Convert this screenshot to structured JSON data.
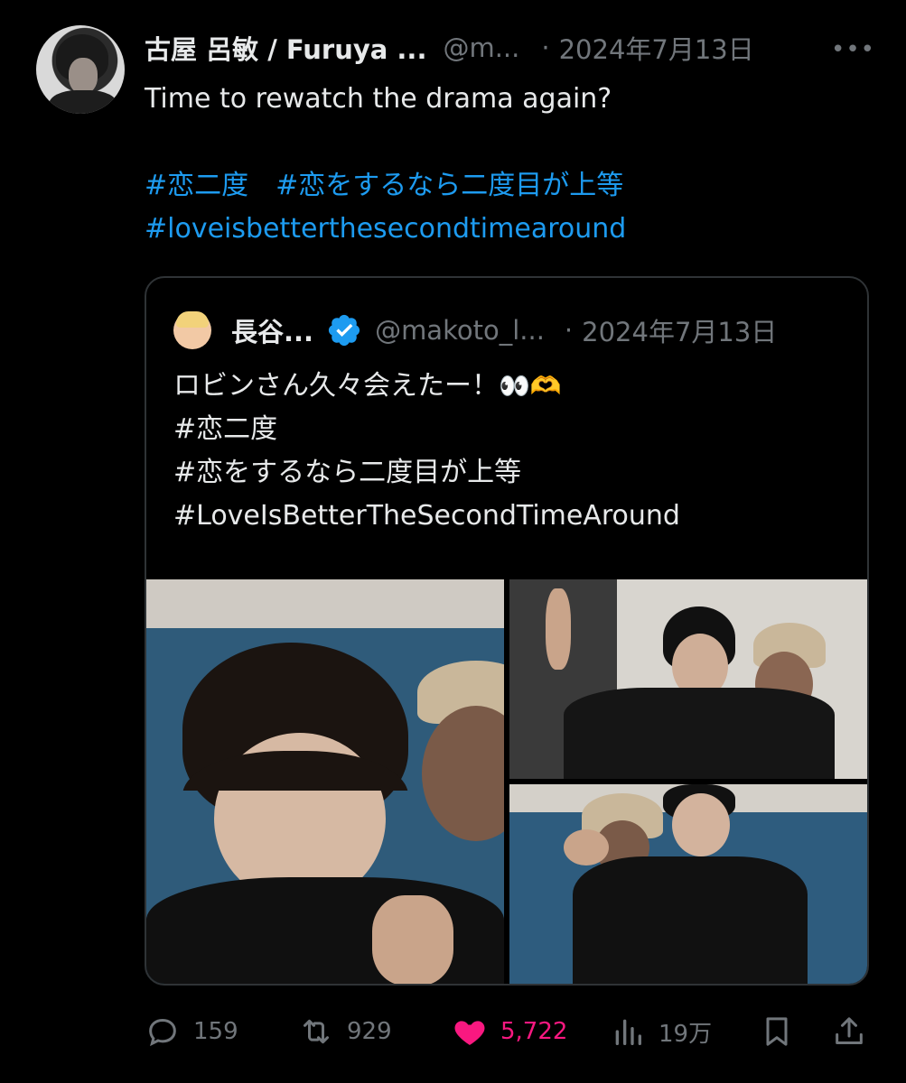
{
  "tweet": {
    "display_name": "古屋 呂敏 / Furuya ...",
    "handle": "@m...",
    "separator": "·",
    "date": "2024年7月13日",
    "more_label": "•••",
    "text": "Time to rewatch the drama again?",
    "hashtags_line1": [
      "#恋二度",
      "#恋をするなら二度目が上等"
    ],
    "hashtags_line2": "#loveisbetterthesecondtimearound"
  },
  "quote": {
    "display_name": "長谷...",
    "handle": "@makoto_l...",
    "separator": "·",
    "date": "2024年7月13日",
    "line1": "ロビンさん久々会えたー！",
    "line1_emoji": "👀🫶",
    "line2": "#恋二度",
    "line3": "#恋をするなら二度目が上等",
    "line4": "#LoveIsBetterTheSecondTimeAround"
  },
  "actions": {
    "reply_count": "159",
    "retweet_count": "929",
    "like_count": "5,722",
    "views_count": "19万"
  },
  "colors": {
    "background": "#000000",
    "text": "#e7e9ea",
    "muted": "#71767b",
    "link": "#1d9bf0",
    "like": "#f91880",
    "verified": "#1d9bf0",
    "border": "#2f3336"
  }
}
